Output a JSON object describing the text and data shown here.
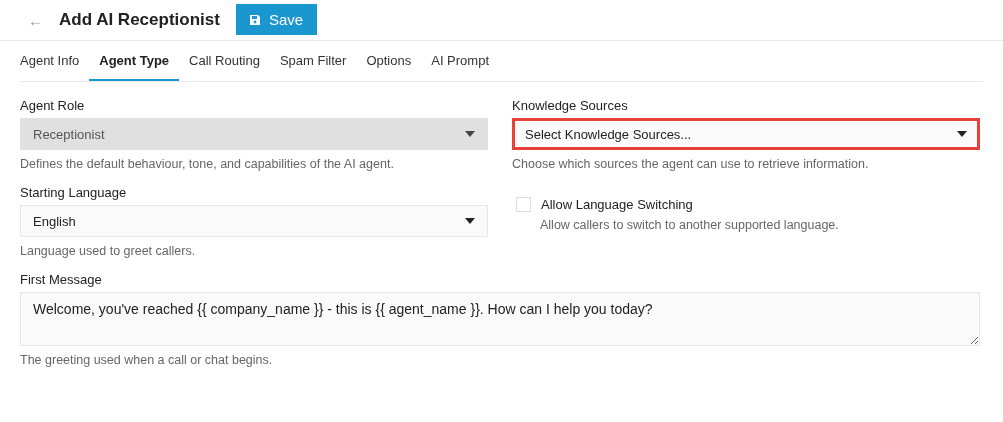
{
  "header": {
    "back_icon": "←",
    "title": "Add AI Receptionist",
    "save_button": "Save"
  },
  "tabs": [
    {
      "label": "Agent Info",
      "selected": false
    },
    {
      "label": "Agent Type",
      "selected": true
    },
    {
      "label": "Call Routing",
      "selected": false
    },
    {
      "label": "Spam Filter",
      "selected": false
    },
    {
      "label": "Options",
      "selected": false
    },
    {
      "label": "AI Prompt",
      "selected": false
    }
  ],
  "agent_role": {
    "label": "Agent Role",
    "value": "Receptionist",
    "disabled": true,
    "help": "Defines the default behaviour, tone, and capabilities of the AI agent."
  },
  "knowledge_sources": {
    "label": "Knowledge Sources",
    "value": "Select Knowledge Sources...",
    "highlighted": true,
    "help": "Choose which sources the agent can use to retrieve information."
  },
  "starting_language": {
    "label": "Starting Language",
    "value": "English",
    "disabled": false,
    "help": "Language used to greet callers."
  },
  "allow_language_switching": {
    "label": "Allow Language Switching",
    "checked": false,
    "help": "Allow callers to switch to another supported language."
  },
  "first_message": {
    "label": "First Message",
    "value": "Welcome, you've reached {{ company_name }} - this is {{ agent_name }}. How can I help you today?",
    "help": "The greeting used when a call or chat begins."
  }
}
